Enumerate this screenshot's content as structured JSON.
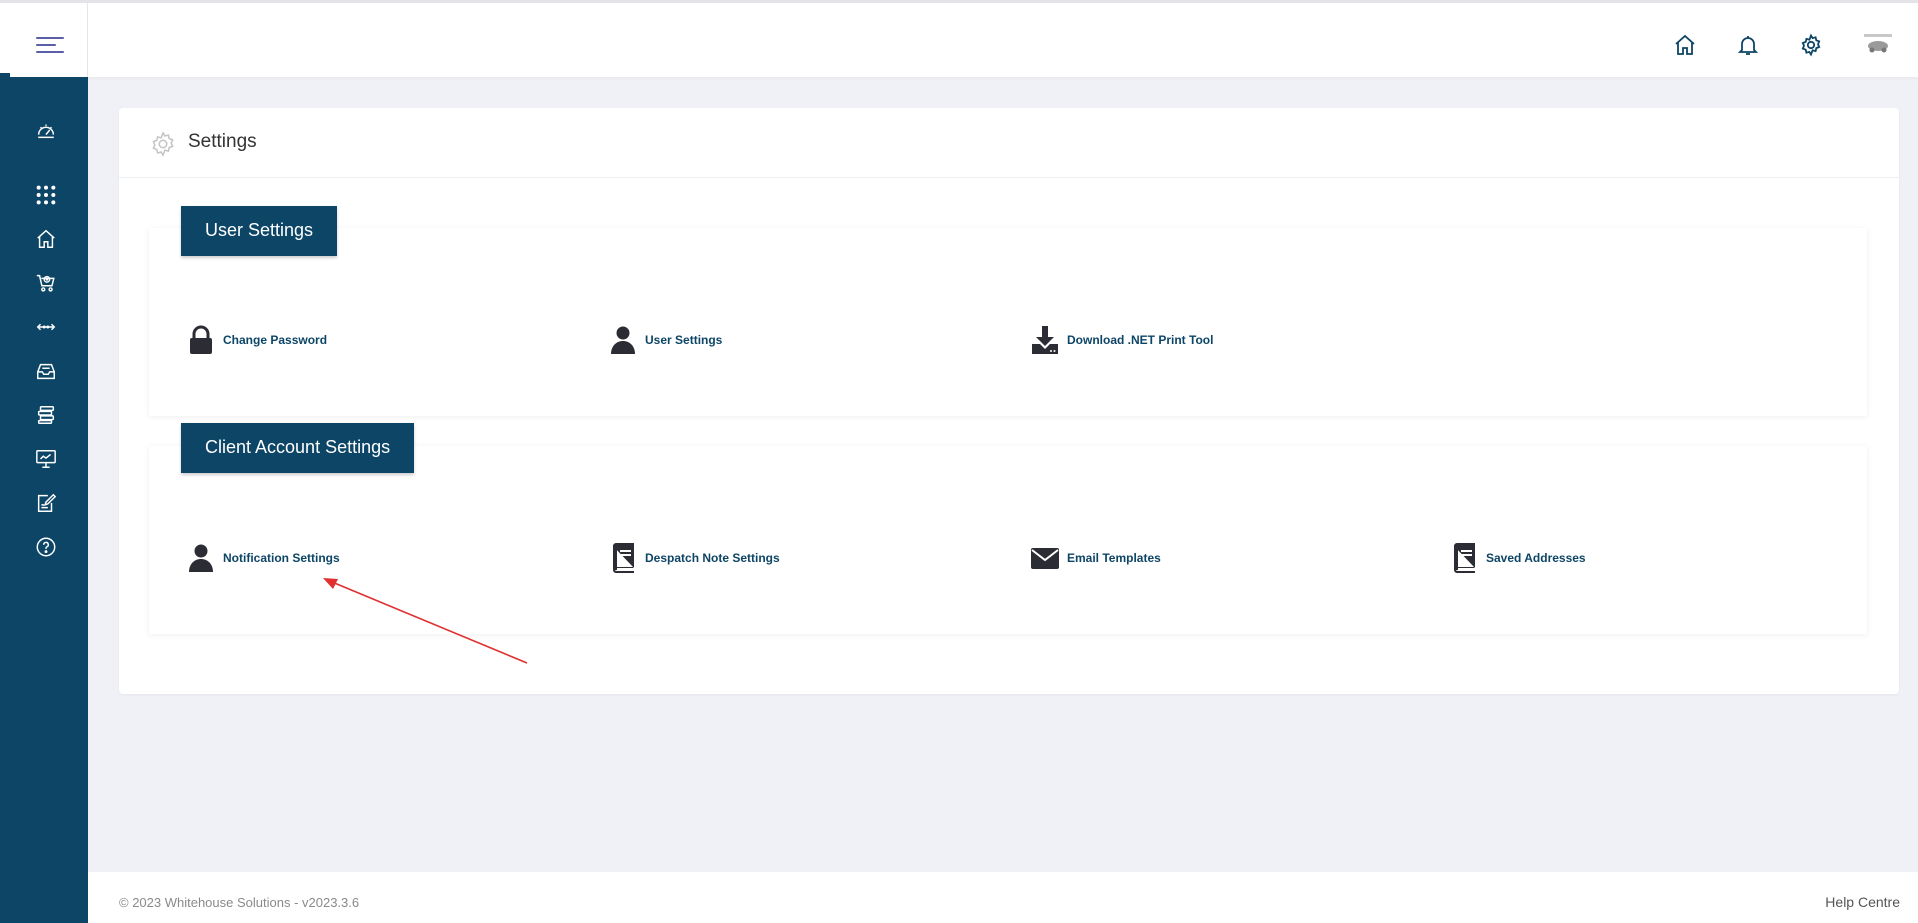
{
  "header": {
    "icons": [
      "home-icon",
      "bell-icon",
      "gear-icon",
      "avatar"
    ]
  },
  "sidebar": {
    "icons": [
      "dashboard-icon",
      "apps-grid-icon",
      "home-icon",
      "cart-icon",
      "transfer-icon",
      "inbox-icon",
      "stack-icon",
      "monitor-icon",
      "edit-icon",
      "help-icon"
    ]
  },
  "page": {
    "title": "Settings"
  },
  "sections": {
    "user": {
      "label": "User Settings",
      "items": [
        {
          "label": "Change Password",
          "icon": "lock-icon"
        },
        {
          "label": "User Settings",
          "icon": "user-icon"
        },
        {
          "label": "Download .NET Print Tool",
          "icon": "download-icon"
        }
      ]
    },
    "client": {
      "label": "Client Account Settings",
      "items": [
        {
          "label": "Notification Settings",
          "icon": "user-icon"
        },
        {
          "label": "Despatch Note Settings",
          "icon": "book-icon"
        },
        {
          "label": "Email Templates",
          "icon": "envelope-icon"
        },
        {
          "label": "Saved Addresses",
          "icon": "book-icon"
        }
      ]
    }
  },
  "footer": {
    "copyright": "© 2023 Whitehouse Solutions - v2023.3.6",
    "help": "Help Centre"
  },
  "colors": {
    "brand": "#0d4566",
    "background": "#f0f1f6",
    "annotation_arrow": "#e03030"
  }
}
